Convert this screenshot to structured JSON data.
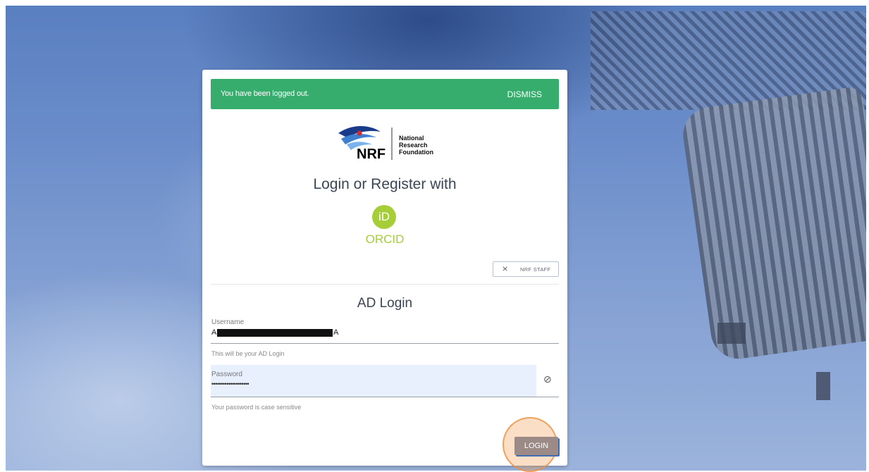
{
  "alert": {
    "message": "You have been logged out.",
    "dismiss_label": "DISMISS"
  },
  "logo": {
    "acronym": "NRF",
    "line1": "National",
    "line2": "Research",
    "line3": "Foundation"
  },
  "login_title": "Login or Register with",
  "orcid": {
    "icon_text": "iD",
    "label": "ORCID"
  },
  "staff_button": {
    "icon": "no-person-icon",
    "label": "NRF STAFF"
  },
  "ad_login": {
    "title": "AD Login",
    "username_label": "Username",
    "username_prefix": "A",
    "username_suffix": "A",
    "username_hint": "This will be your AD Login",
    "password_label": "Password",
    "password_value": "••••••••••••••••••••",
    "password_hint": "Your password is case sensitive",
    "login_button": "LOGIN"
  },
  "colors": {
    "alert": "#36ad6d",
    "orcid": "#a6ce39",
    "login_button": "#9b8a86"
  }
}
